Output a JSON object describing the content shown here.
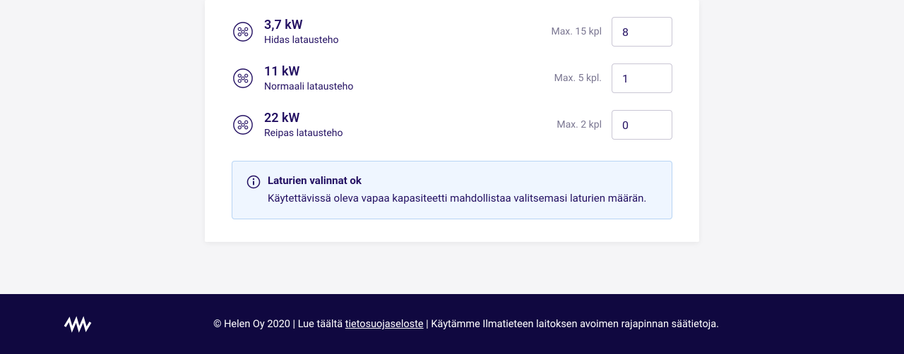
{
  "chargers": [
    {
      "power_label": "3,7 kW",
      "speed_label": "Hidas latausteho",
      "max_label": "Max. 15 kpl",
      "value": "8"
    },
    {
      "power_label": "11 kW",
      "speed_label": "Normaali latausteho",
      "max_label": "Max. 5 kpl.",
      "value": "1"
    },
    {
      "power_label": "22 kW",
      "speed_label": "Reipas latausteho",
      "max_label": "Max. 2 kpl",
      "value": "0"
    }
  ],
  "info": {
    "title": "Laturien valinnat ok",
    "body": "Käytettävissä oleva vapaa kapasiteetti mahdollistaa valitsemasi laturien määrän."
  },
  "footer": {
    "copyright": "© Helen Oy 2020",
    "sep": " | ",
    "privacy_prefix": "Lue täältä ",
    "privacy_link": "tietosuojaseloste",
    "weather": "Käytämme Ilmatieteen laitoksen avoimen rajapinnan säätietoja."
  }
}
